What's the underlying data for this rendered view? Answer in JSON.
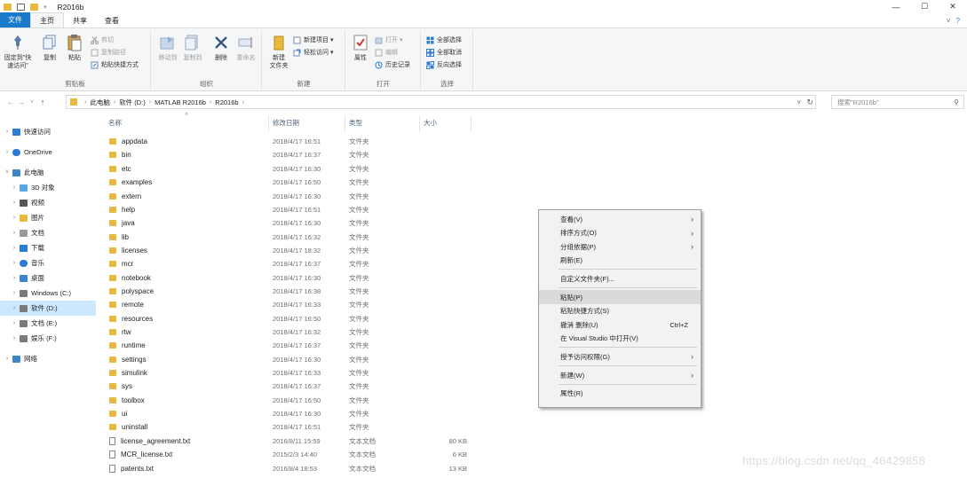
{
  "window": {
    "title": "R2016b",
    "controls": [
      "—",
      "☐",
      "✕"
    ]
  },
  "quick_access": {
    "dropdown": "▾"
  },
  "tabs": [
    {
      "label": "文件",
      "kind": "file"
    },
    {
      "label": "主页",
      "kind": "active"
    },
    {
      "label": "共享",
      "kind": "normal"
    },
    {
      "label": "查看",
      "kind": "normal"
    }
  ],
  "tabs_right": {
    "expand": "˅",
    "help": "?"
  },
  "ribbon": {
    "clipboard": {
      "label": "剪贴板",
      "pin": "固定到\"快速访问\"",
      "copy": "复制",
      "paste": "粘贴",
      "cut": "剪切",
      "copy_path": "复制路径",
      "paste_shortcut": "粘贴快捷方式"
    },
    "organize": {
      "label": "组织",
      "move_to": "移动到",
      "copy_to": "复制到",
      "delete": "删除",
      "rename": "重命名"
    },
    "new": {
      "label": "新建",
      "new_folder": "新建\n文件夹",
      "new_item": "新建项目 ▾",
      "easy_access": "轻松访问 ▾"
    },
    "open": {
      "label": "打开",
      "properties": "属性",
      "open": "打开 ▾",
      "edit": "编辑",
      "history": "历史记录"
    },
    "select": {
      "label": "选择",
      "select_all": "全部选择",
      "select_none": "全部取消",
      "invert": "反向选择"
    }
  },
  "address": {
    "nav": [
      "←",
      "→",
      "˅",
      "↑"
    ],
    "crumbs": [
      "此电脑",
      "软件 (D:)",
      "MATLAB R2016b",
      "R2016b"
    ],
    "sep": "›",
    "dropdown": "˅",
    "refresh": "↻"
  },
  "search": {
    "placeholder": "搜索\"R2016b\"",
    "icon": "⚲"
  },
  "nav_pane": [
    {
      "label": "快速访问",
      "arrow": "›",
      "icon": "star",
      "color": "#2b7cd3",
      "indent": 0
    },
    {
      "label": "OneDrive",
      "arrow": "›",
      "icon": "cloud",
      "color": "#2b7cd3",
      "indent": 0
    },
    {
      "label": "此电脑",
      "arrow": "˅",
      "icon": "pc",
      "color": "#3a86c8",
      "indent": 0
    },
    {
      "label": "3D 对象",
      "arrow": "›",
      "icon": "3d",
      "color": "#5aa5e6",
      "indent": 1
    },
    {
      "label": "视频",
      "arrow": "›",
      "icon": "video",
      "color": "#555555",
      "indent": 1
    },
    {
      "label": "图片",
      "arrow": "›",
      "icon": "picture",
      "color": "#e7b93c",
      "indent": 1
    },
    {
      "label": "文档",
      "arrow": "›",
      "icon": "doc",
      "color": "#9a9a9a",
      "indent": 1
    },
    {
      "label": "下载",
      "arrow": "›",
      "icon": "download",
      "color": "#2b7cd3",
      "indent": 1
    },
    {
      "label": "音乐",
      "arrow": "›",
      "icon": "music",
      "color": "#2b7cd3",
      "indent": 1
    },
    {
      "label": "桌面",
      "arrow": "›",
      "icon": "desktop",
      "color": "#3a86c8",
      "indent": 1
    },
    {
      "label": "Windows (C:)",
      "arrow": "›",
      "icon": "drive",
      "color": "#7a7a7a",
      "indent": 1
    },
    {
      "label": "软件 (D:)",
      "arrow": "›",
      "icon": "drive",
      "color": "#7a7a7a",
      "indent": 1,
      "selected": true
    },
    {
      "label": "文档 (E:)",
      "arrow": "›",
      "icon": "drive",
      "color": "#7a7a7a",
      "indent": 1
    },
    {
      "label": "娱乐 (F:)",
      "arrow": "›",
      "icon": "drive",
      "color": "#7a7a7a",
      "indent": 1
    },
    {
      "label": "网络",
      "arrow": "›",
      "icon": "network",
      "color": "#3a86c8",
      "indent": 0
    }
  ],
  "columns": {
    "name": "名称",
    "date": "修改日期",
    "type": "类型",
    "size": "大小",
    "sort_arrow": "˄"
  },
  "files": [
    {
      "name": "appdata",
      "date": "2018/4/17 16:51",
      "type": "文件夹",
      "size": "",
      "kind": "folder"
    },
    {
      "name": "bin",
      "date": "2018/4/17 16:37",
      "type": "文件夹",
      "size": "",
      "kind": "folder"
    },
    {
      "name": "etc",
      "date": "2018/4/17 16:30",
      "type": "文件夹",
      "size": "",
      "kind": "folder"
    },
    {
      "name": "examples",
      "date": "2018/4/17 16:50",
      "type": "文件夹",
      "size": "",
      "kind": "folder"
    },
    {
      "name": "extern",
      "date": "2018/4/17 16:30",
      "type": "文件夹",
      "size": "",
      "kind": "folder"
    },
    {
      "name": "help",
      "date": "2018/4/17 16:51",
      "type": "文件夹",
      "size": "",
      "kind": "folder"
    },
    {
      "name": "java",
      "date": "2018/4/17 16:30",
      "type": "文件夹",
      "size": "",
      "kind": "folder"
    },
    {
      "name": "lib",
      "date": "2018/4/17 16:32",
      "type": "文件夹",
      "size": "",
      "kind": "folder"
    },
    {
      "name": "licenses",
      "date": "2018/4/17 18:32",
      "type": "文件夹",
      "size": "",
      "kind": "folder"
    },
    {
      "name": "mcr",
      "date": "2018/4/17 16:37",
      "type": "文件夹",
      "size": "",
      "kind": "folder"
    },
    {
      "name": "notebook",
      "date": "2018/4/17 16:30",
      "type": "文件夹",
      "size": "",
      "kind": "folder"
    },
    {
      "name": "polyspace",
      "date": "2018/4/17 16:38",
      "type": "文件夹",
      "size": "",
      "kind": "folder"
    },
    {
      "name": "remote",
      "date": "2018/4/17 16:33",
      "type": "文件夹",
      "size": "",
      "kind": "folder"
    },
    {
      "name": "resources",
      "date": "2018/4/17 16:50",
      "type": "文件夹",
      "size": "",
      "kind": "folder"
    },
    {
      "name": "rtw",
      "date": "2018/4/17 16:32",
      "type": "文件夹",
      "size": "",
      "kind": "folder"
    },
    {
      "name": "runtime",
      "date": "2018/4/17 16:37",
      "type": "文件夹",
      "size": "",
      "kind": "folder"
    },
    {
      "name": "settings",
      "date": "2018/4/17 16:30",
      "type": "文件夹",
      "size": "",
      "kind": "folder"
    },
    {
      "name": "simulink",
      "date": "2018/4/17 16:33",
      "type": "文件夹",
      "size": "",
      "kind": "folder"
    },
    {
      "name": "sys",
      "date": "2018/4/17 16:37",
      "type": "文件夹",
      "size": "",
      "kind": "folder"
    },
    {
      "name": "toolbox",
      "date": "2018/4/17 16:50",
      "type": "文件夹",
      "size": "",
      "kind": "folder"
    },
    {
      "name": "ui",
      "date": "2018/4/17 16:30",
      "type": "文件夹",
      "size": "",
      "kind": "folder"
    },
    {
      "name": "uninstall",
      "date": "2018/4/17 16:51",
      "type": "文件夹",
      "size": "",
      "kind": "folder"
    },
    {
      "name": "license_agreement.txt",
      "date": "2016/8/11 15:59",
      "type": "文本文档",
      "size": "80 KB",
      "kind": "doc"
    },
    {
      "name": "MCR_license.txt",
      "date": "2015/2/3 14:40",
      "type": "文本文档",
      "size": "6 KB",
      "kind": "doc"
    },
    {
      "name": "patents.txt",
      "date": "2016/8/4 18:53",
      "type": "文本文档",
      "size": "13 KB",
      "kind": "doc"
    }
  ],
  "context_menu": [
    {
      "label": "查看(V)",
      "sub": "›"
    },
    {
      "label": "排序方式(O)",
      "sub": "›"
    },
    {
      "label": "分组依据(P)",
      "sub": "›"
    },
    {
      "label": "刷新(E)"
    },
    {
      "sep": true
    },
    {
      "label": "自定义文件夹(F)..."
    },
    {
      "sep": true
    },
    {
      "label": "粘贴(P)",
      "highlight": true
    },
    {
      "label": "粘贴快捷方式(S)"
    },
    {
      "label": "撤消 删除(U)",
      "shortcut": "Ctrl+Z"
    },
    {
      "label": "在 Visual Studio 中打开(V)"
    },
    {
      "sep": true
    },
    {
      "label": "授予访问权限(G)",
      "sub": "›"
    },
    {
      "sep": true
    },
    {
      "label": "新建(W)",
      "sub": "›"
    },
    {
      "sep": true
    },
    {
      "label": "属性(R)"
    }
  ],
  "watermark": "https://blog.csdn.net/qq_46429858"
}
